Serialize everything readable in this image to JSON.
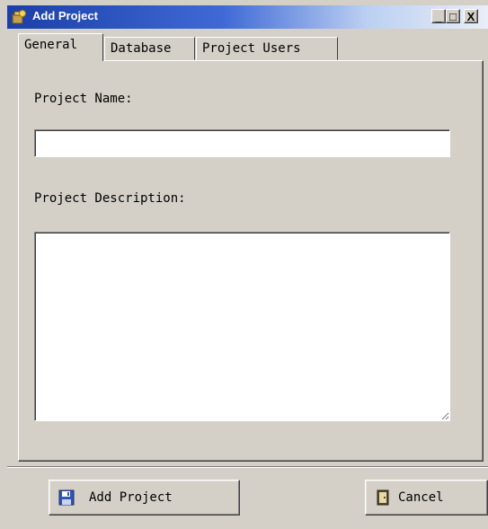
{
  "window": {
    "title": "Add Project",
    "title_buttons": {
      "minimize": "_",
      "maximize": "□",
      "close": "X"
    }
  },
  "tabs": [
    {
      "label": "General",
      "active": true
    },
    {
      "label": "Database",
      "active": false
    },
    {
      "label": "Project Users",
      "active": false
    }
  ],
  "form": {
    "project_name_label": "Project Name:",
    "project_name_value": "",
    "project_description_label": "Project Description:",
    "project_description_value": ""
  },
  "buttons": {
    "add_project": "Add Project",
    "add_project_icon": "floppy-disk-icon",
    "cancel": "Cancel",
    "cancel_icon": "door-exit-icon"
  },
  "colors": {
    "face": "#d4d0c8",
    "titlebar_start": "#1b3fa8",
    "titlebar_end": "#e9eef7"
  }
}
